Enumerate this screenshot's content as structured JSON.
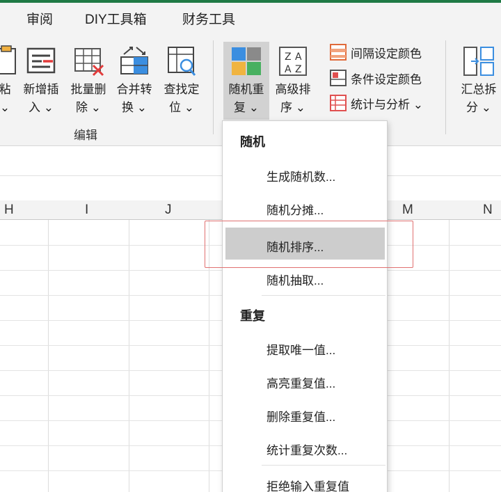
{
  "tabs": [
    "审阅",
    "DIY工具箱",
    "财务工具"
  ],
  "ribbon": {
    "buttons": [
      {
        "label": "粘\n⌄",
        "icon": "paste-icon"
      },
      {
        "label": "新增插\n入 ⌄",
        "icon": "insert-rows-icon"
      },
      {
        "label": "批量删\n除 ⌄",
        "icon": "batch-delete-icon"
      },
      {
        "label": "合并转\n换 ⌄",
        "icon": "merge-convert-icon"
      },
      {
        "label": "查找定\n位 ⌄",
        "icon": "find-locate-icon"
      },
      {
        "label": "随机重\n复 ⌄",
        "icon": "random-repeat-icon"
      },
      {
        "label": "高级排\n序 ⌄",
        "icon": "advanced-sort-icon"
      },
      {
        "label": "汇总拆\n分 ⌄",
        "icon": "summary-split-icon"
      }
    ],
    "small_buttons": [
      {
        "label": "间隔设定颜色",
        "icon": "interval-color-icon"
      },
      {
        "label": "条件设定颜色",
        "icon": "condition-color-icon"
      },
      {
        "label": "统计与分析 ⌄",
        "icon": "stats-analysis-icon"
      }
    ],
    "group_label": "编辑"
  },
  "columns": [
    "H",
    "I",
    "J",
    "M",
    "N"
  ],
  "menu": {
    "sections": [
      {
        "heading": "随机",
        "items": [
          "生成随机数...",
          "随机分摊...",
          "随机排序...",
          "随机抽取..."
        ]
      },
      {
        "heading": "重复",
        "items": [
          "提取唯一值...",
          "高亮重复值...",
          "删除重复值...",
          "统计重复次数...",
          "拒绝输入重复值"
        ]
      }
    ],
    "highlighted_item": "随机排序..."
  },
  "colors": {
    "accent_top": "#1f7a45",
    "highlight": "#cdcdcd",
    "callout": "#e07070"
  }
}
